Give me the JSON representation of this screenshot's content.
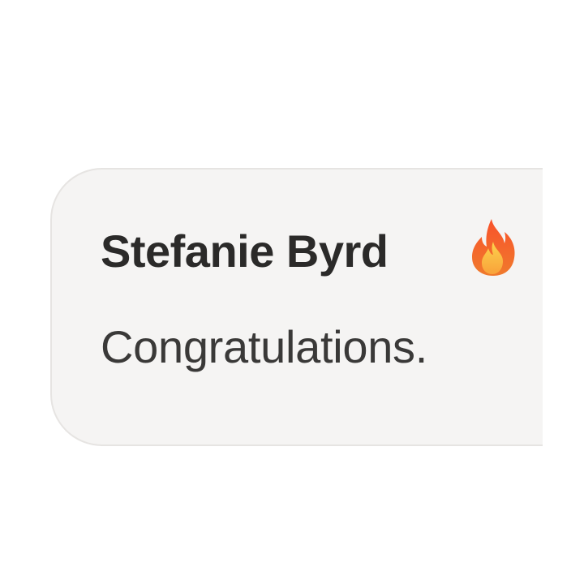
{
  "comment": {
    "author": "Stefanie Byrd",
    "badge_icon": "flame-icon",
    "text": "Congratulations."
  },
  "colors": {
    "bubble_background": "#f5f4f3",
    "bubble_border": "#e6e4e2",
    "author_text": "#2b2a29",
    "body_text": "#3a3938",
    "flame_outer": "#f36b2a",
    "flame_inner": "#fbb33b"
  }
}
